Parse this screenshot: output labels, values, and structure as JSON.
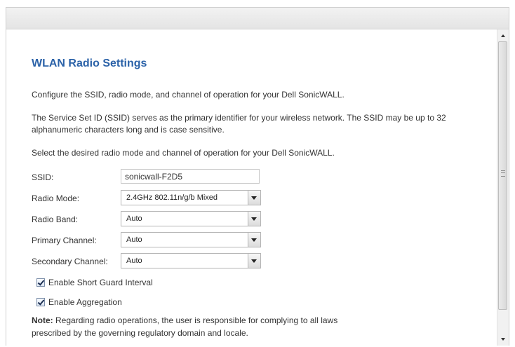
{
  "page": {
    "title": "WLAN Radio Settings",
    "intro": "Configure the SSID, radio mode, and channel of operation for your Dell SonicWALL.",
    "ssid_description": "The Service Set ID (SSID) serves as the primary identifier for your wireless network. The SSID may be up to 32 alphanumeric characters long and is case sensitive.",
    "select_instruction": "Select the desired radio mode and channel of operation for your Dell SonicWALL."
  },
  "form": {
    "ssid": {
      "label": "SSID:",
      "value": "sonicwall-F2D5"
    },
    "radio_mode": {
      "label": "Radio Mode:",
      "value": "2.4GHz 802.11n/g/b Mixed"
    },
    "radio_band": {
      "label": "Radio Band:",
      "value": "Auto"
    },
    "primary_channel": {
      "label": "Primary Channel:",
      "value": "Auto"
    },
    "secondary_channel": {
      "label": "Secondary Channel:",
      "value": "Auto"
    },
    "short_guard": {
      "label": "Enable Short Guard Interval",
      "checked": true
    },
    "aggregation": {
      "label": "Enable Aggregation",
      "checked": true
    }
  },
  "note": {
    "prefix": "Note:",
    "text": " Regarding radio operations, the user is responsible for complying to all laws prescribed by the governing regulatory domain and locale."
  },
  "colors": {
    "title": "#2b62a8",
    "text": "#333333",
    "header": "#e8e8e8"
  },
  "scrollbar": {
    "grip_icon": "grip-icon"
  }
}
